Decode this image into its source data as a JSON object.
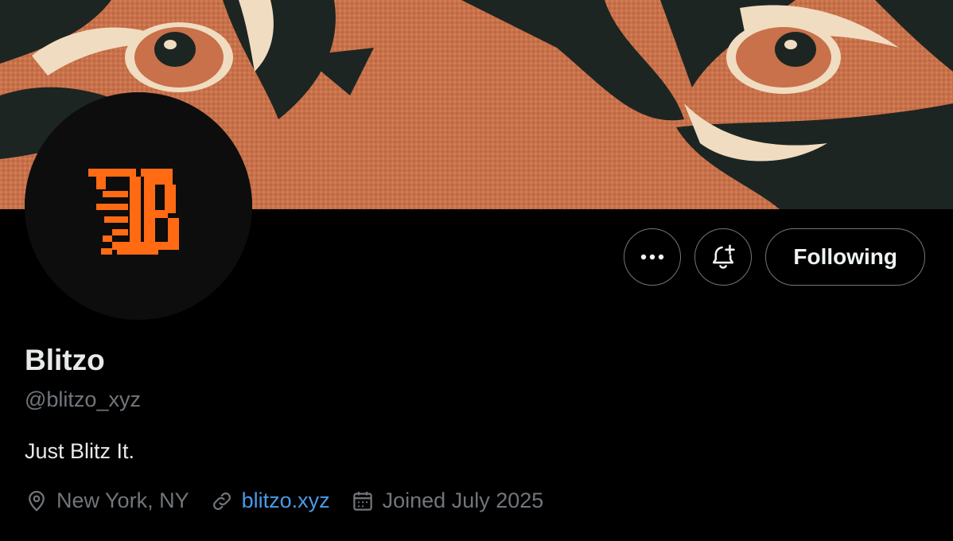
{
  "profile": {
    "display_name": "Blitzo",
    "handle": "@blitzo_xyz",
    "bio": "Just Blitz It.",
    "location": "New York, NY",
    "website": "blitzo.xyz",
    "joined": "Joined July 2025"
  },
  "actions": {
    "following_label": "Following"
  },
  "icons": {
    "more": "more-horizontal-icon",
    "notify": "bell-plus-icon",
    "location": "location-pin-icon",
    "link": "link-icon",
    "calendar": "calendar-icon"
  },
  "colors": {
    "background": "#000000",
    "link": "#4a99e9",
    "muted": "#71767b",
    "logo_orange": "#ff6a13"
  }
}
